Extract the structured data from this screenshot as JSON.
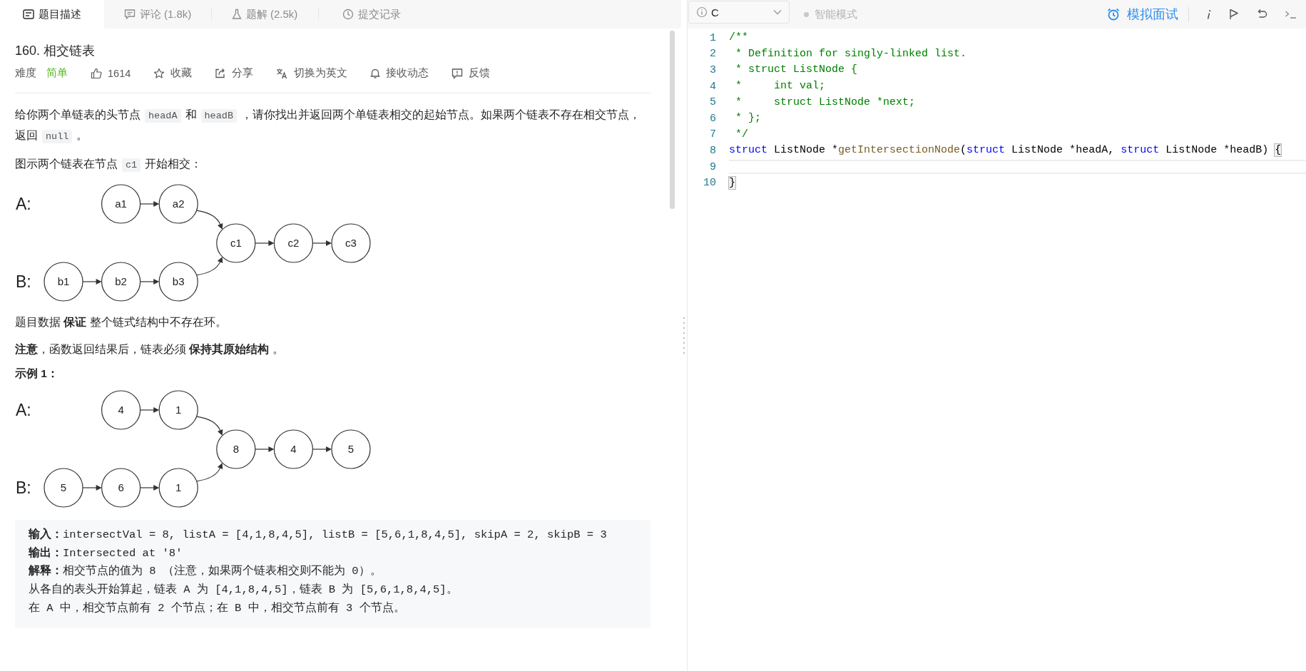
{
  "tabs": [
    {
      "label": "题目描述",
      "kind": "description",
      "selected": true
    },
    {
      "label": "评论 (1.8k)",
      "kind": "comments",
      "selected": false
    },
    {
      "label": "题解 (2.5k)",
      "kind": "solutions",
      "selected": false
    },
    {
      "label": "提交记录",
      "kind": "submissions",
      "selected": false
    }
  ],
  "problem": {
    "title": "160. 相交链表",
    "difficulty_label": "难度",
    "difficulty": "简单",
    "actions": [
      {
        "kind": "like",
        "label": "1614"
      },
      {
        "kind": "star",
        "label": "收藏"
      },
      {
        "kind": "share",
        "label": "分享"
      },
      {
        "kind": "translate",
        "label": "切换为英文"
      },
      {
        "kind": "bell",
        "label": "接收动态"
      },
      {
        "kind": "feedback",
        "label": "反馈"
      }
    ]
  },
  "content": [
    {
      "kind": "paragraph",
      "segments": [
        {
          "kind": "text",
          "text": "给你两个单链表的头节点"
        },
        {
          "kind": "code",
          "text": "headA"
        },
        {
          "kind": "text",
          "text": "和"
        },
        {
          "kind": "code",
          "text": "headB"
        },
        {
          "kind": "text",
          "text": "，请你找出并返回两个单链表相交的起始节点。如果两个链表不存在相交节点，返回"
        },
        {
          "kind": "code",
          "text": "null"
        },
        {
          "kind": "text",
          "text": "。"
        }
      ]
    },
    {
      "kind": "paragraph",
      "segments": [
        {
          "kind": "text",
          "text": "图示两个链表在节点"
        },
        {
          "kind": "code",
          "text": "c1"
        },
        {
          "kind": "text",
          "text": "开始相交："
        }
      ]
    },
    {
      "kind": "diagram",
      "label_a": "A:",
      "label_b": "B:",
      "list_a": [
        "a1",
        "a2"
      ],
      "list_b": [
        "b1",
        "b2",
        "b3"
      ],
      "shared": [
        "c1",
        "c2",
        "c3"
      ]
    },
    {
      "kind": "paragraph",
      "segments": [
        {
          "kind": "text",
          "text": "题目数据 **保证** 整个链式结构中不存在环。"
        }
      ]
    },
    {
      "kind": "paragraph",
      "segments": [
        {
          "kind": "text",
          "text": "**注意**，函数返回结果后，链表必须 **保持其原始结构** 。"
        }
      ]
    },
    {
      "kind": "heading",
      "text": "示例 1："
    },
    {
      "kind": "diagram",
      "label_a": "A:",
      "label_b": "B:",
      "list_a": [
        "4",
        "1"
      ],
      "list_b": [
        "5",
        "6",
        "1"
      ],
      "shared": [
        "8",
        "4",
        "5"
      ]
    },
    {
      "kind": "example",
      "lines": [
        "**输入：**intersectVal = 8, listA = [4,1,8,4,5], listB = [5,6,1,8,4,5], skipA = 2, skipB = 3",
        "**输出：**Intersected at '8'",
        "**解释：**相交节点的值为 8 （注意，如果两个链表相交则不能为 0）。",
        "从各自的表头开始算起，链表 A 为 [4,1,8,4,5]，链表 B 为 [5,6,1,8,4,5]。",
        "在 A 中，相交节点前有 2 个节点；在 B 中，相交节点前有 3 个节点。"
      ]
    }
  ],
  "editor": {
    "language": "C",
    "mode": "智能模式",
    "interview": "模拟面试",
    "lines": [
      {
        "number": "1",
        "active": false,
        "tokens": [
          {
            "kind": "comment",
            "text": "/**"
          }
        ]
      },
      {
        "number": "2",
        "active": false,
        "tokens": [
          {
            "kind": "comment",
            "text": " * Definition for singly-linked list."
          }
        ]
      },
      {
        "number": "3",
        "active": false,
        "tokens": [
          {
            "kind": "comment",
            "text": " * struct ListNode {"
          }
        ]
      },
      {
        "number": "4",
        "active": false,
        "tokens": [
          {
            "kind": "comment",
            "text": " *     int val;"
          }
        ]
      },
      {
        "number": "5",
        "active": false,
        "tokens": [
          {
            "kind": "comment",
            "text": " *     struct ListNode *next;"
          }
        ]
      },
      {
        "number": "6",
        "active": false,
        "tokens": [
          {
            "kind": "comment",
            "text": " * };"
          }
        ]
      },
      {
        "number": "7",
        "active": false,
        "tokens": [
          {
            "kind": "comment",
            "text": " */"
          }
        ]
      },
      {
        "number": "8",
        "active": false,
        "tokens": [
          {
            "kind": "keyword",
            "text": "struct"
          },
          {
            "kind": "plain",
            "text": " ListNode *"
          },
          {
            "kind": "function",
            "text": "getIntersectionNode"
          },
          {
            "kind": "plain",
            "text": "("
          },
          {
            "kind": "keyword",
            "text": "struct"
          },
          {
            "kind": "plain",
            "text": " ListNode *headA, "
          },
          {
            "kind": "keyword",
            "text": "struct"
          },
          {
            "kind": "plain",
            "text": " ListNode *headB) "
          },
          {
            "kind": "bracket",
            "text": "{"
          }
        ]
      },
      {
        "number": "9",
        "active": true
      },
      {
        "number": "10",
        "active": false,
        "tokens": [
          {
            "kind": "bracket",
            "text": "}"
          }
        ]
      }
    ]
  }
}
